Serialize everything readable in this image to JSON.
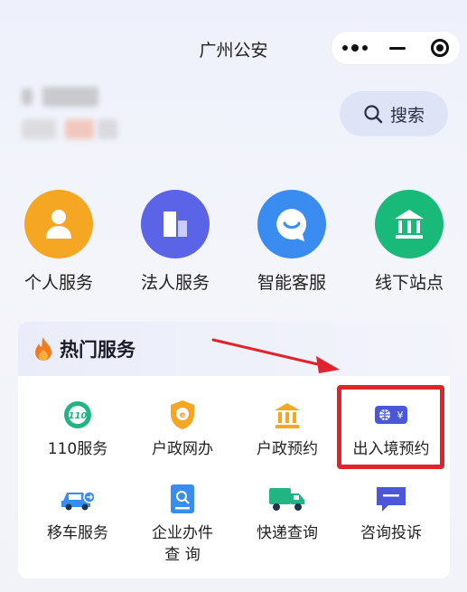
{
  "header": {
    "title": "广州公安"
  },
  "search": {
    "label": "搜索"
  },
  "quick_actions": [
    {
      "label": "个人服务",
      "icon": "person-icon",
      "color": "#f5a623"
    },
    {
      "label": "法人服务",
      "icon": "building-icon",
      "color": "#5b63e6"
    },
    {
      "label": "智能客服",
      "icon": "chat-bubble-icon",
      "color": "#3b8cf0"
    },
    {
      "label": "线下站点",
      "icon": "bank-icon",
      "color": "#19b97a"
    }
  ],
  "hot_services": {
    "title": "热门服务",
    "items": [
      {
        "label": "110服务",
        "icon": "110-icon"
      },
      {
        "label": "户政网办",
        "icon": "shield-badge-icon"
      },
      {
        "label": "户政预约",
        "icon": "bank-icon"
      },
      {
        "label": "出入境预约",
        "icon": "passport-card-icon"
      },
      {
        "label": "移车服务",
        "icon": "car-icon"
      },
      {
        "label": "企业办件\n查 询",
        "icon": "document-search-icon"
      },
      {
        "label": "快递查询",
        "icon": "truck-icon"
      },
      {
        "label": "咨询投诉",
        "icon": "message-icon"
      }
    ]
  },
  "annotation": {
    "highlight_color": "#e0232c"
  }
}
